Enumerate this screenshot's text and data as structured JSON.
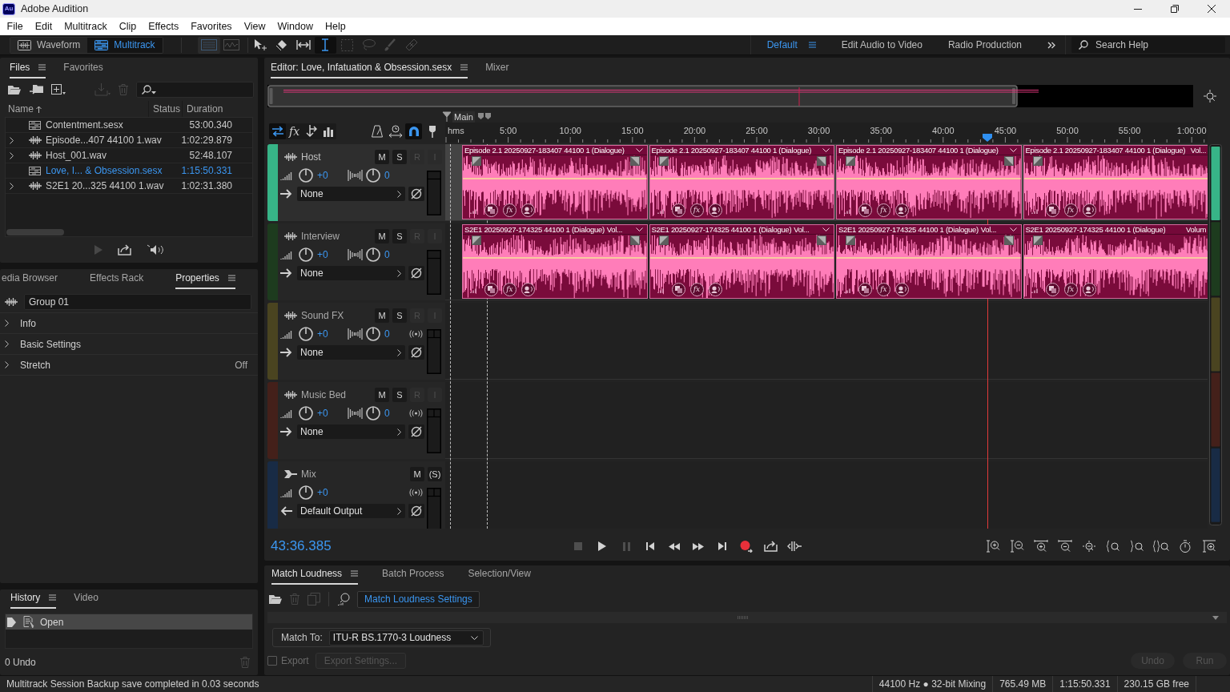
{
  "window": {
    "logo": "Au",
    "title": "Adobe Audition"
  },
  "menu": [
    "File",
    "Edit",
    "Multitrack",
    "Clip",
    "Effects",
    "Favorites",
    "View",
    "Window",
    "Help"
  ],
  "toolbar": {
    "modes": [
      {
        "kind": "waveform",
        "label": "Waveform",
        "selected": false
      },
      {
        "kind": "multitrack",
        "label": "Multitrack",
        "selected": true
      }
    ],
    "views": [
      {
        "kind": "spectral",
        "selected": true,
        "disabled": true
      },
      {
        "kind": "pitch",
        "selected": false,
        "disabled": true
      }
    ],
    "tools": [
      {
        "kind": "move",
        "selected": false,
        "disabled": false
      },
      {
        "kind": "razor",
        "selected": false,
        "disabled": false
      },
      {
        "kind": "slip",
        "selected": false,
        "disabled": false
      },
      {
        "kind": "time-selection",
        "selected": true,
        "disabled": false
      },
      {
        "kind": "marquee",
        "selected": false,
        "disabled": true
      },
      {
        "kind": "lasso",
        "selected": false,
        "disabled": true
      },
      {
        "kind": "brush",
        "selected": false,
        "disabled": true
      },
      {
        "kind": "healing",
        "selected": false,
        "disabled": true
      }
    ],
    "workspaces": [
      {
        "label": "Default",
        "selected": true
      },
      {
        "label": "Edit Audio to Video",
        "selected": false
      },
      {
        "label": "Radio Production",
        "selected": false
      }
    ],
    "search": {
      "placeholder": "Search Help"
    }
  },
  "files_panel": {
    "tabs": [
      {
        "label": "Files",
        "selected": true
      },
      {
        "label": "Favorites",
        "selected": false
      }
    ],
    "toolbar": [
      {
        "kind": "open",
        "disabled": false
      },
      {
        "kind": "import",
        "disabled": false
      },
      {
        "kind": "new",
        "disabled": false
      },
      {
        "kind": "insert",
        "disabled": true
      },
      {
        "kind": "remove",
        "disabled": true
      }
    ],
    "columns": [
      "Name",
      "Status",
      "Duration"
    ],
    "rows": [
      {
        "kind": "session",
        "name": "Contentment.sesx",
        "duration": "53:00.340",
        "expandable": false,
        "selected": false
      },
      {
        "kind": "audio",
        "name": "Episode...407 44100 1.wav",
        "duration": "1:02:29.879",
        "expandable": true,
        "selected": false
      },
      {
        "kind": "audio",
        "name": "Host_001.wav",
        "duration": "52:48.107",
        "expandable": true,
        "selected": false
      },
      {
        "kind": "session",
        "name": "Love, I... & Obsession.sesx",
        "duration": "1:15:50.331",
        "expandable": false,
        "selected": true
      },
      {
        "kind": "audio",
        "name": "S2E1 20...325 44100 1.wav",
        "duration": "1:02:31.380",
        "expandable": true,
        "selected": false
      }
    ],
    "footer": [
      {
        "kind": "play",
        "disabled": true
      },
      {
        "kind": "loop",
        "disabled": false
      },
      {
        "kind": "autoplay",
        "disabled": false
      }
    ]
  },
  "properties_panel": {
    "tabs": [
      {
        "label": "edia Browser",
        "selected": false
      },
      {
        "label": "Effects Rack",
        "selected": false
      },
      {
        "label": "Properties",
        "selected": true
      }
    ],
    "name_field": {
      "value": "Group 01"
    },
    "sections": [
      {
        "label": "Info",
        "expanded": false
      },
      {
        "label": "Basic Settings",
        "expanded": false
      },
      {
        "label": "Stretch",
        "value": "Off",
        "expanded": false
      }
    ]
  },
  "history_panel": {
    "tabs": [
      {
        "label": "History",
        "selected": true
      },
      {
        "label": "Video",
        "selected": false
      }
    ],
    "items": [
      {
        "label": "Open",
        "selected": true
      }
    ],
    "undo_count": "0 Undo",
    "toolbar": [
      {
        "kind": "remove",
        "disabled": true
      }
    ]
  },
  "editor": {
    "tabs": [
      {
        "label": "Editor: Love, Infatuation & Obsession.sesx",
        "selected": true
      },
      {
        "label": "Mixer",
        "selected": false
      }
    ],
    "header_tools": [
      {
        "kind": "io",
        "on": true
      },
      {
        "kind": "effects",
        "label": "fx",
        "on": false
      },
      {
        "kind": "sends",
        "on": false
      },
      {
        "kind": "eq",
        "on": false
      }
    ],
    "timeline_tools": [
      {
        "kind": "metronome",
        "on": false
      },
      {
        "kind": "scroll-sync",
        "on": false
      },
      {
        "kind": "snap",
        "on": true
      },
      {
        "kind": "marker",
        "on": false
      }
    ],
    "marker": {
      "label": "Main"
    },
    "ruler": {
      "unit": "hms",
      "labels": [
        "5:00",
        "10:00",
        "15:00",
        "20:00",
        "25:00",
        "30:00",
        "35:00",
        "40:00",
        "45:00",
        "50:00",
        "55:00",
        "1:00:00"
      ]
    },
    "playhead": {
      "level": 0.711
    },
    "tracks": [
      {
        "kind": "audio",
        "name": "Host",
        "color": "#37b487",
        "selected": true,
        "buttons": [
          {
            "label": "M",
            "disabled": false
          },
          {
            "label": "S",
            "disabled": false
          },
          {
            "label": "R",
            "disabled": true
          },
          {
            "label": "I",
            "disabled": true
          }
        ],
        "volume": "+0",
        "pan": "0",
        "route": "None",
        "stereo": false,
        "clips": [
          {
            "title": "Episode 2.1 20250927-183407 44100 1 (Dialogue)",
            "cut_off": false,
            "effects_label": "fx"
          },
          {
            "title": "Episode 2.1 20250927-183407 44100 1 (Dialogue)",
            "cut_off": false,
            "effects_label": "fx"
          },
          {
            "title": "Episode 2.1 20250927-183407 44100 1 (Dialogue)",
            "cut_off": false,
            "effects_label": "fx"
          },
          {
            "title": "Episode 2.1 20250927-183407 44100 1 (Dialogue)",
            "envelope": "Vol...",
            "cut_off": true,
            "effects_label": "fx"
          }
        ]
      },
      {
        "kind": "audio",
        "name": "Interview",
        "color": "#1d3b1e",
        "selected": false,
        "buttons": [
          {
            "label": "M",
            "disabled": false
          },
          {
            "label": "S",
            "disabled": false
          },
          {
            "label": "R",
            "disabled": true
          },
          {
            "label": "I",
            "disabled": true
          }
        ],
        "volume": "+0",
        "pan": "0",
        "route": "None",
        "stereo": false,
        "clips": [
          {
            "title": "S2E1 20250927-174325 44100 1 (Dialogue)",
            "envelope": "Vol...",
            "cut_off": false,
            "effects_label": "fx"
          },
          {
            "title": "S2E1 20250927-174325 44100 1 (Dialogue)",
            "envelope": "Vol...",
            "cut_off": false,
            "effects_label": "fx"
          },
          {
            "title": "S2E1 20250927-174325 44100 1 (Dialogue)",
            "envelope": "Vol...",
            "cut_off": false,
            "effects_label": "fx"
          },
          {
            "title": "S2E1 20250927-174325 44100 1 (Dialogue)",
            "envelope": "Volum",
            "cut_off": true,
            "effects_label": "fx"
          }
        ]
      },
      {
        "kind": "audio",
        "name": "Sound FX",
        "color": "#4a4420",
        "selected": false,
        "buttons": [
          {
            "label": "M",
            "disabled": false
          },
          {
            "label": "S",
            "disabled": false
          },
          {
            "label": "R",
            "disabled": true
          },
          {
            "label": "I",
            "disabled": true
          }
        ],
        "volume": "+0",
        "pan": "0",
        "route": "None",
        "stereo": true
      },
      {
        "kind": "audio",
        "name": "Music Bed",
        "color": "#44201a",
        "selected": false,
        "buttons": [
          {
            "label": "M",
            "disabled": false
          },
          {
            "label": "S",
            "disabled": false
          },
          {
            "label": "R",
            "disabled": true
          },
          {
            "label": "I",
            "disabled": true
          }
        ],
        "volume": "+0",
        "pan": "0",
        "route": "None",
        "stereo": true
      },
      {
        "kind": "master",
        "name": "Mix",
        "color": "#182b45",
        "selected": false,
        "buttons": [
          {
            "label": "M",
            "disabled": false
          },
          {
            "label": "(S)",
            "disabled": false
          }
        ],
        "volume": "+0",
        "route": "Default Output",
        "stereo": true
      }
    ],
    "time": "43:36.385",
    "transport": [
      {
        "kind": "stop",
        "disabled": true
      },
      {
        "kind": "play",
        "disabled": false
      },
      {
        "kind": "pause",
        "disabled": true
      },
      {
        "kind": "start",
        "disabled": false
      },
      {
        "kind": "rewind",
        "disabled": false
      },
      {
        "kind": "forward",
        "disabled": false
      },
      {
        "kind": "end",
        "disabled": false
      },
      {
        "kind": "record",
        "disabled": false
      },
      {
        "kind": "loop",
        "disabled": false
      },
      {
        "kind": "skip",
        "disabled": false
      }
    ]
  },
  "match_loudness": {
    "tabs": [
      {
        "label": "Match Loudness",
        "selected": true
      },
      {
        "label": "Batch Process",
        "selected": false
      },
      {
        "label": "Selection/View",
        "selected": false
      }
    ],
    "toolbar": [
      {
        "kind": "open",
        "disabled": false
      },
      {
        "kind": "remove",
        "disabled": true
      },
      {
        "kind": "duplicate",
        "disabled": true
      },
      {
        "kind": "analyze",
        "disabled": false
      }
    ],
    "settings_button": "Match Loudness Settings",
    "match_to": {
      "label": "Match To:",
      "value": "ITU-R BS.1770-3 Loudness"
    },
    "export": {
      "label": "Export",
      "checked": false
    },
    "export_settings": {
      "label": "Export Settings...",
      "disabled": true
    },
    "actions": [
      {
        "label": "Undo",
        "disabled": true
      },
      {
        "label": "Run",
        "disabled": true
      }
    ]
  },
  "status_bar": {
    "message": "Multitrack Session Backup save completed in 0.03 seconds",
    "fields": [
      "44100 Hz ● 32-bit Mixing",
      "765.49 MB",
      "1:15:50.331",
      "230.15 GB free"
    ]
  }
}
